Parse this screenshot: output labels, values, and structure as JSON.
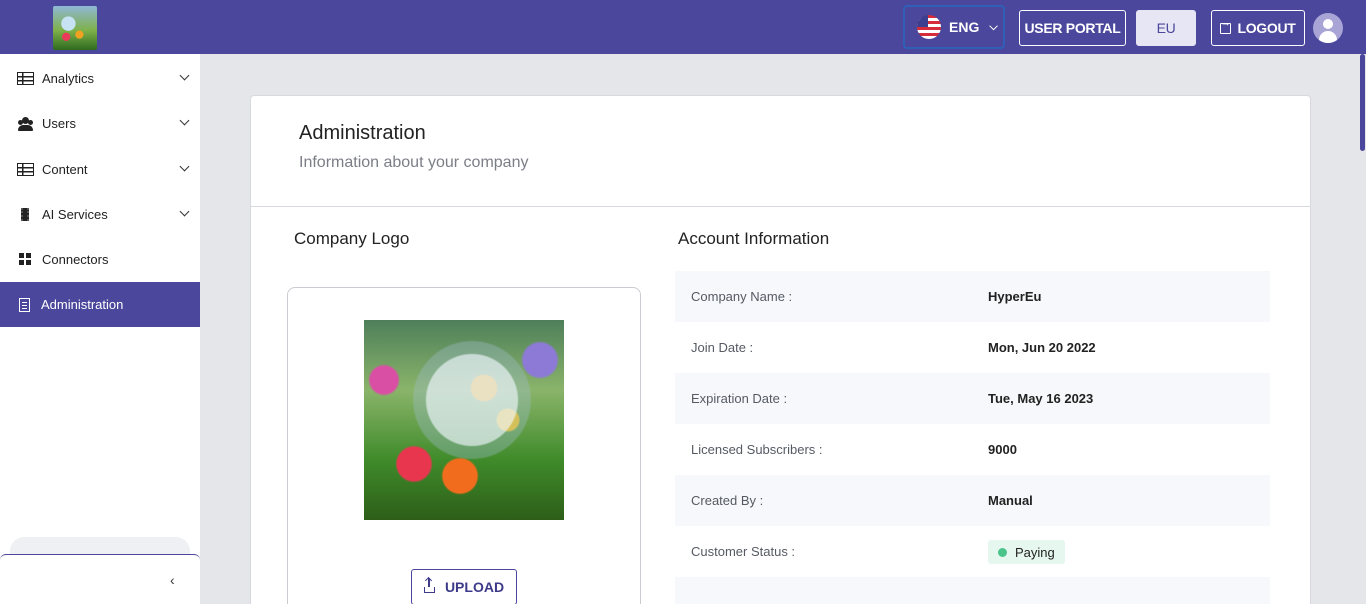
{
  "topbar": {
    "language": "ENG",
    "user_portal": "USER PORTAL",
    "region": "EU",
    "logout": "LOGOUT"
  },
  "sidebar": {
    "items": [
      {
        "label": "Analytics",
        "icon": "table-icon",
        "expandable": true
      },
      {
        "label": "Users",
        "icon": "users-icon",
        "expandable": true
      },
      {
        "label": "Content",
        "icon": "table-icon",
        "expandable": true
      },
      {
        "label": "AI Services",
        "icon": "chip-icon",
        "expandable": true
      },
      {
        "label": "Connectors",
        "icon": "grid-icon",
        "expandable": false
      },
      {
        "label": "Administration",
        "icon": "document-icon",
        "expandable": false,
        "active": true
      }
    ],
    "collapse_glyph": "‹"
  },
  "main": {
    "title": "Administration",
    "subtitle": "Information about your company",
    "logo_section": {
      "title": "Company Logo",
      "upload_label": "UPLOAD"
    },
    "account_section": {
      "title": "Account Information",
      "rows": [
        {
          "label": "Company Name :",
          "value": "HyperEu"
        },
        {
          "label": "Join Date :",
          "value": "Mon, Jun 20 2022"
        },
        {
          "label": "Expiration Date :",
          "value": "Tue, May 16 2023"
        },
        {
          "label": "Licensed Subscribers :",
          "value": "9000"
        },
        {
          "label": "Created By :",
          "value": "Manual"
        },
        {
          "label": "Customer Status :",
          "value": "Paying"
        }
      ]
    }
  },
  "colors": {
    "brand": "#4b479c",
    "status_paying": "#4bc48b"
  }
}
